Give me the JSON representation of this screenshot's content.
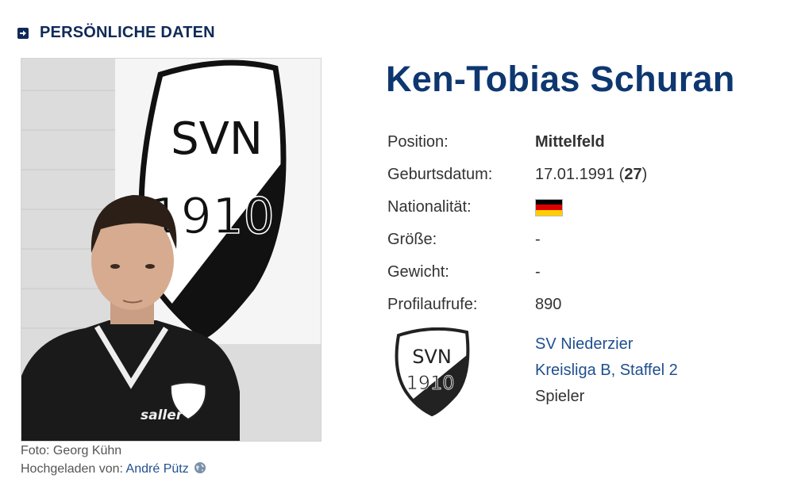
{
  "section": {
    "title": "PERSÖNLICHE DATEN",
    "icon": "arrow-right-square-icon"
  },
  "photo": {
    "alt": "Ken-Tobias Schuran",
    "crest_text_top": "SVN",
    "crest_text_bottom": "1910",
    "shirt_brand": "saller",
    "caption_photo": "Foto: Georg Kühn",
    "caption_uploaded_label": "Hochgeladen von:",
    "caption_uploader": "André Pütz",
    "uploader_icon": "globe-icon"
  },
  "player": {
    "name": "Ken-Tobias Schuran",
    "details": [
      {
        "label": "Position:",
        "value": "Mittelfeld"
      },
      {
        "label": "Geburtsdatum:",
        "value_date": "17.01.1991",
        "value_age": "27"
      },
      {
        "label": "Nationalität:",
        "flag": "germany-flag",
        "flag_colors": [
          "#000000",
          "#dd0000",
          "#ffce00"
        ]
      },
      {
        "label": "Größe:",
        "value": "-"
      },
      {
        "label": "Gewicht:",
        "value": "-"
      },
      {
        "label": "Profilaufrufe:",
        "value": "890"
      }
    ]
  },
  "club": {
    "logo_text_top": "SVN",
    "logo_text_bottom": "1910",
    "name": "SV Niederzier",
    "league": "Kreisliga B, Staffel 2",
    "role": "Spieler"
  },
  "colors": {
    "heading": "#0e2a57",
    "name": "#0e3770",
    "link": "#1f4f8f"
  }
}
